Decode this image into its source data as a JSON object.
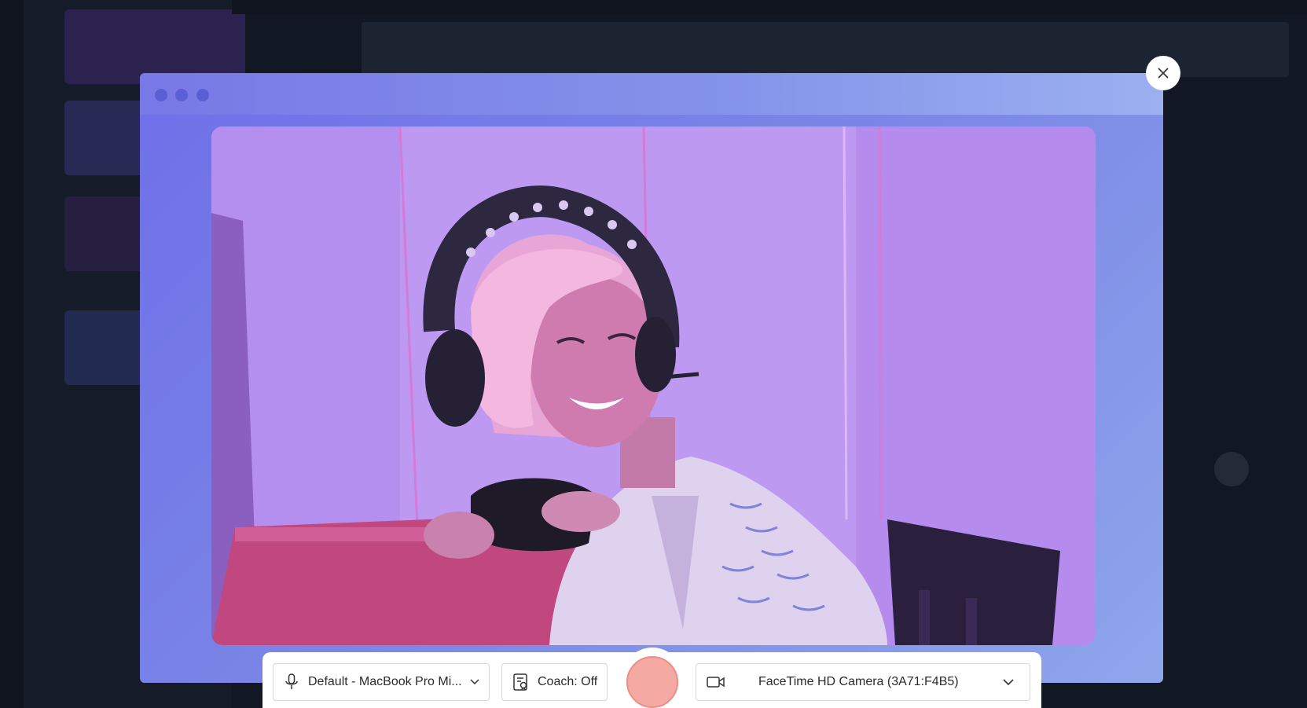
{
  "recorder": {
    "microphone": {
      "label": "Default - MacBook Pro Mi...",
      "icon": "microphone-icon"
    },
    "coach": {
      "label": "Coach: Off",
      "icon": "coach-icon"
    },
    "record": {
      "icon": "record-icon",
      "color": "#f4a9a3"
    },
    "camera": {
      "label": "FaceTime HD Camera (3A71:F4B5)",
      "icon": "video-camera-icon"
    },
    "close": {
      "icon": "close-icon"
    }
  },
  "colors": {
    "window_gradient_start": "#6f6fe8",
    "window_gradient_end": "#8fa6ec",
    "record_button": "#f4a9a3"
  }
}
